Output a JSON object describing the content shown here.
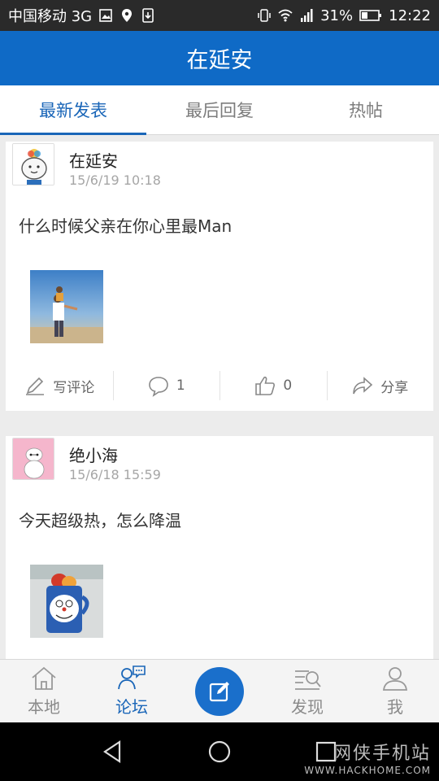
{
  "status_bar": {
    "carrier": "中国移动 3G",
    "network": "3G",
    "battery": "31%",
    "time": "12:22"
  },
  "app": {
    "title": "在延安"
  },
  "tabs": [
    {
      "label": "最新发表",
      "active": true
    },
    {
      "label": "最后回复",
      "active": false
    },
    {
      "label": "热帖",
      "active": false
    }
  ],
  "posts": [
    {
      "author": "在延安",
      "time": "15/6/19 10:18",
      "text": "什么时候父亲在你心里最Man",
      "actions": {
        "comment_label": "写评论",
        "comments": "1",
        "likes": "0",
        "share_label": "分享"
      }
    },
    {
      "author": "绝小海",
      "time": "15/6/18 15:59",
      "text": "今天超级热，怎么降温"
    }
  ],
  "bottom_nav": [
    {
      "label": "本地",
      "icon": "home-icon"
    },
    {
      "label": "论坛",
      "icon": "forum-icon",
      "active": true
    },
    {
      "label": "",
      "icon": "compose-icon"
    },
    {
      "label": "发现",
      "icon": "discover-icon"
    },
    {
      "label": "我",
      "icon": "profile-icon"
    }
  ],
  "watermark": {
    "title": "网侠手机站",
    "url": "WWW.HACKHOME.COM"
  },
  "colors": {
    "brand": "#0f6ac6",
    "accent": "#1a66b8"
  }
}
